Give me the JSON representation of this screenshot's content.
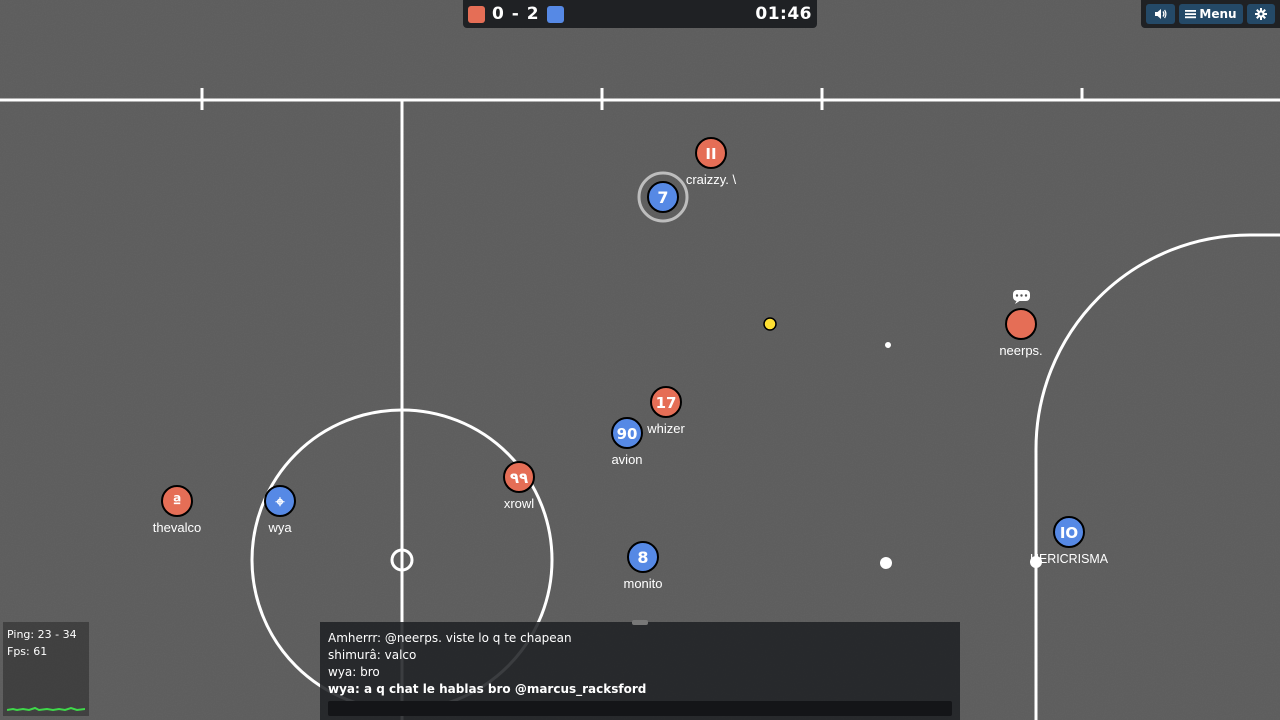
{
  "scoreboard": {
    "red_score": "0",
    "separator": "-",
    "blue_score": "2",
    "clock": "01:46",
    "red_color": "#e56e56",
    "blue_color": "#5689e5"
  },
  "controls": {
    "sound_icon": "speaker-icon",
    "menu_label": "Menu",
    "menu_icon": "hamburger-icon",
    "settings_icon": "gear-icon"
  },
  "players": [
    {
      "team": "red",
      "avatar": "II",
      "name": "craizzy. \\"
    },
    {
      "team": "blue",
      "avatar": "7",
      "name": ""
    },
    {
      "team": "red",
      "avatar": "",
      "name": "neerps."
    },
    {
      "team": "red",
      "avatar": "17",
      "name": "whizer"
    },
    {
      "team": "blue",
      "avatar": "90",
      "name": "avion"
    },
    {
      "team": "red",
      "avatar": "٩٩",
      "name": "xrowl"
    },
    {
      "team": "red",
      "avatar": "ª",
      "name": "thevalco"
    },
    {
      "team": "blue",
      "avatar": "⌖",
      "name": "wya"
    },
    {
      "team": "blue",
      "avatar": "8",
      "name": "monito"
    },
    {
      "team": "blue",
      "avatar": "IO",
      "name": "HERICRISMA"
    }
  ],
  "ball_color": "#ffe033",
  "stats": {
    "ping": "Ping: 23 - 34",
    "fps": "Fps: 61"
  },
  "chat": {
    "messages": [
      {
        "text": "Amherrr: @neerps. viste lo q te chapean",
        "bold": false
      },
      {
        "text": "shimurâ: valco",
        "bold": false
      },
      {
        "text": "wya: bro",
        "bold": false
      },
      {
        "text": "wya: a q chat le hablas bro @marcus_racksford",
        "bold": true
      }
    ],
    "input_value": ""
  }
}
